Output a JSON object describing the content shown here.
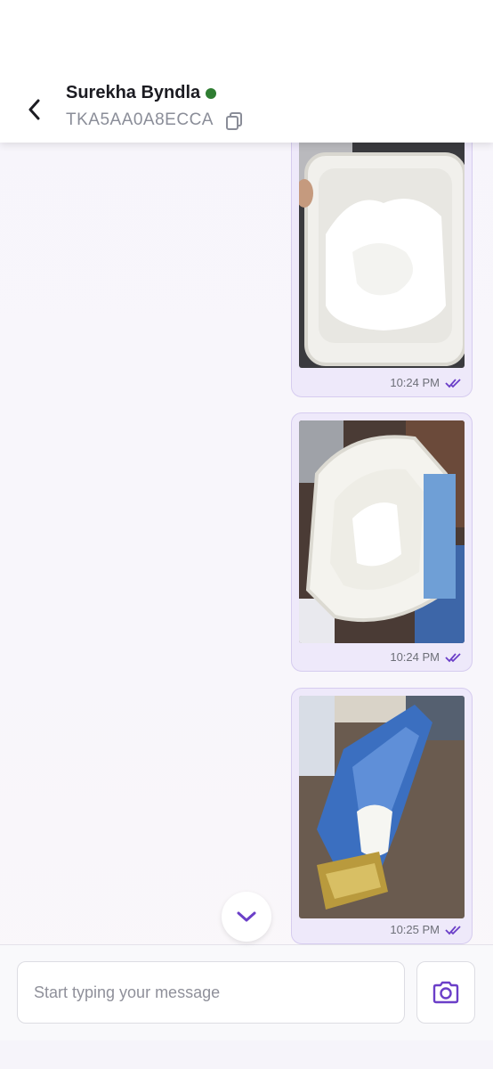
{
  "header": {
    "contact_name": "Surekha Byndla",
    "contact_id": "TKA5AA0A8ECCA",
    "online_status": "online",
    "icons": [
      "back-arrow-icon",
      "copy-icon"
    ]
  },
  "messages": [
    {
      "type": "image",
      "content": "photo of an opened ice cream tub with melted vanilla ice cream",
      "time": "10:24 PM",
      "status": "read"
    },
    {
      "type": "image",
      "content": "photo of an ice cream tub tilted, melted contents",
      "time": "10:24 PM",
      "status": "read"
    },
    {
      "type": "image",
      "content": "photo of an opened vanilla ice cream bar wrapper with melting ice cream",
      "time": "10:25 PM",
      "status": "read"
    }
  ],
  "composer": {
    "placeholder": "Start typing your message",
    "value": ""
  },
  "colors": {
    "accent": "#6b3fc8",
    "bubble_bg": "#eee9fa",
    "online": "#2f7d32"
  }
}
